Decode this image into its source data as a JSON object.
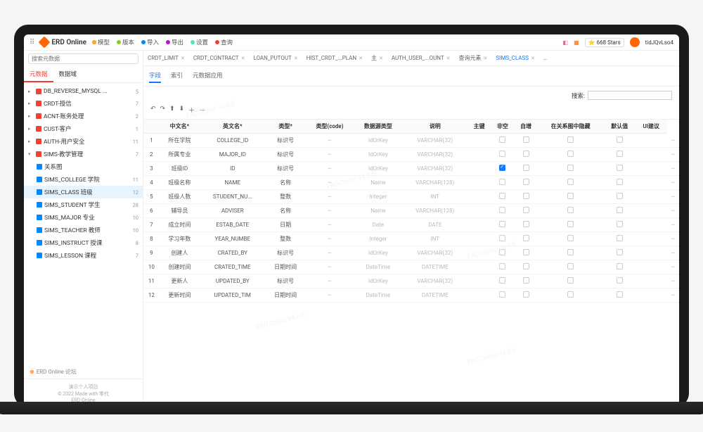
{
  "header": {
    "appName": "ERD Online",
    "menu": [
      "模型",
      "版本",
      "导入",
      "导出",
      "设置",
      "查询"
    ],
    "stars": "668 Stars",
    "user": "tidJQvLso4"
  },
  "sidebar": {
    "searchPlaceholder": "搜索元数据",
    "tabs": [
      "元数据",
      "数据域"
    ],
    "tree": [
      {
        "label": "DB_REVERSE_MYSQL ...",
        "count": "5",
        "arrow": "▸"
      },
      {
        "label": "CRDT-授信",
        "count": "7",
        "arrow": "▸"
      },
      {
        "label": "ACNT-账务处理",
        "count": "2",
        "arrow": "▸"
      },
      {
        "label": "CUST-客户",
        "count": "1",
        "arrow": "▸"
      },
      {
        "label": "AUTH-用户安全",
        "count": "11",
        "arrow": "▸"
      },
      {
        "label": "SIMS-教学管理",
        "count": "7",
        "arrow": "▾",
        "children": [
          {
            "label": "关系图",
            "count": ""
          },
          {
            "label": "SIMS_COLLEGE 学院",
            "count": "11"
          },
          {
            "label": "SIMS_CLASS 班级",
            "count": "12",
            "selected": true
          },
          {
            "label": "SIMS_STUDENT 学生",
            "count": "28"
          },
          {
            "label": "SIMS_MAJOR 专业",
            "count": "10"
          },
          {
            "label": "SIMS_TEACHER 教师",
            "count": "10"
          },
          {
            "label": "SIMS_INSTRUCT 授课",
            "count": "8"
          },
          {
            "label": "SIMS_LESSON 课程",
            "count": "7"
          }
        ]
      }
    ],
    "forum": "ERD Online 论坛",
    "footer": [
      "演示个人项目",
      "© 2022 Made with 零代",
      "ERD Online"
    ]
  },
  "mainTabs": [
    {
      "label": "CRDT_LIMIT"
    },
    {
      "label": "CRDT_CONTRACT"
    },
    {
      "label": "LOAN_PUTOUT"
    },
    {
      "label": "HIST_CRDT_...PLAN"
    },
    {
      "label": "主"
    },
    {
      "label": "AUTH_USER_...OUNT"
    },
    {
      "label": "查询元素"
    },
    {
      "label": "SIMS_CLASS",
      "active": true
    }
  ],
  "subTabs": [
    "字段",
    "索引",
    "元数据应用"
  ],
  "searchLabel": "搜索:",
  "columns": [
    "",
    "中文名*",
    "英文名*",
    "类型*",
    "类型(code)",
    "数据源类型",
    "说明",
    "主键",
    "非空",
    "自增",
    "在关系图中隐藏",
    "默认值",
    "UI建议"
  ],
  "rows": [
    {
      "n": "1",
      "cn": "所在学院",
      "en": "COLLEGE_ID",
      "type": "标识号",
      "code": "IdOrKey",
      "src": "VARCHAR(32)",
      "pk": false
    },
    {
      "n": "2",
      "cn": "所属专业",
      "en": "MAJOR_ID",
      "type": "标识号",
      "code": "IdOrKey",
      "src": "VARCHAR(32)",
      "pk": false
    },
    {
      "n": "3",
      "cn": "班级ID",
      "en": "ID",
      "type": "标识号",
      "code": "IdOrKey",
      "src": "VARCHAR(32)",
      "pk": true
    },
    {
      "n": "4",
      "cn": "班级名称",
      "en": "NAME",
      "type": "名称",
      "code": "Name",
      "src": "VARCHAR(128)",
      "pk": false
    },
    {
      "n": "5",
      "cn": "班级人数",
      "en": "STUDENT_NU...",
      "type": "整数",
      "code": "Integer",
      "src": "INT",
      "pk": false
    },
    {
      "n": "6",
      "cn": "辅导员",
      "en": "ADVISER",
      "type": "名称",
      "code": "Name",
      "src": "VARCHAR(128)",
      "pk": false
    },
    {
      "n": "7",
      "cn": "成立时间",
      "en": "ESTAB_DATE",
      "type": "日期",
      "code": "Date",
      "src": "DATE",
      "pk": false
    },
    {
      "n": "8",
      "cn": "学习年数",
      "en": "YEAR_NUMBE",
      "type": "整数",
      "code": "Integer",
      "src": "INT",
      "pk": false
    },
    {
      "n": "9",
      "cn": "创建人",
      "en": "CRATED_BY",
      "type": "标识号",
      "code": "IdOrKey",
      "src": "VARCHAR(32)",
      "pk": false
    },
    {
      "n": "10",
      "cn": "创建时间",
      "en": "CRATED_TIME",
      "type": "日期时间",
      "code": "DateTime",
      "src": "DATETIME",
      "pk": false
    },
    {
      "n": "11",
      "cn": "更新人",
      "en": "UPDATED_BY",
      "type": "标识号",
      "code": "IdOrKey",
      "src": "VARCHAR(32)",
      "pk": false
    },
    {
      "n": "12",
      "cn": "更新时间",
      "en": "UPDATED_TIM",
      "type": "日期时间",
      "code": "DateTime",
      "src": "DATETIME",
      "pk": false
    }
  ],
  "watermark": "ERD Online V4.0.5"
}
